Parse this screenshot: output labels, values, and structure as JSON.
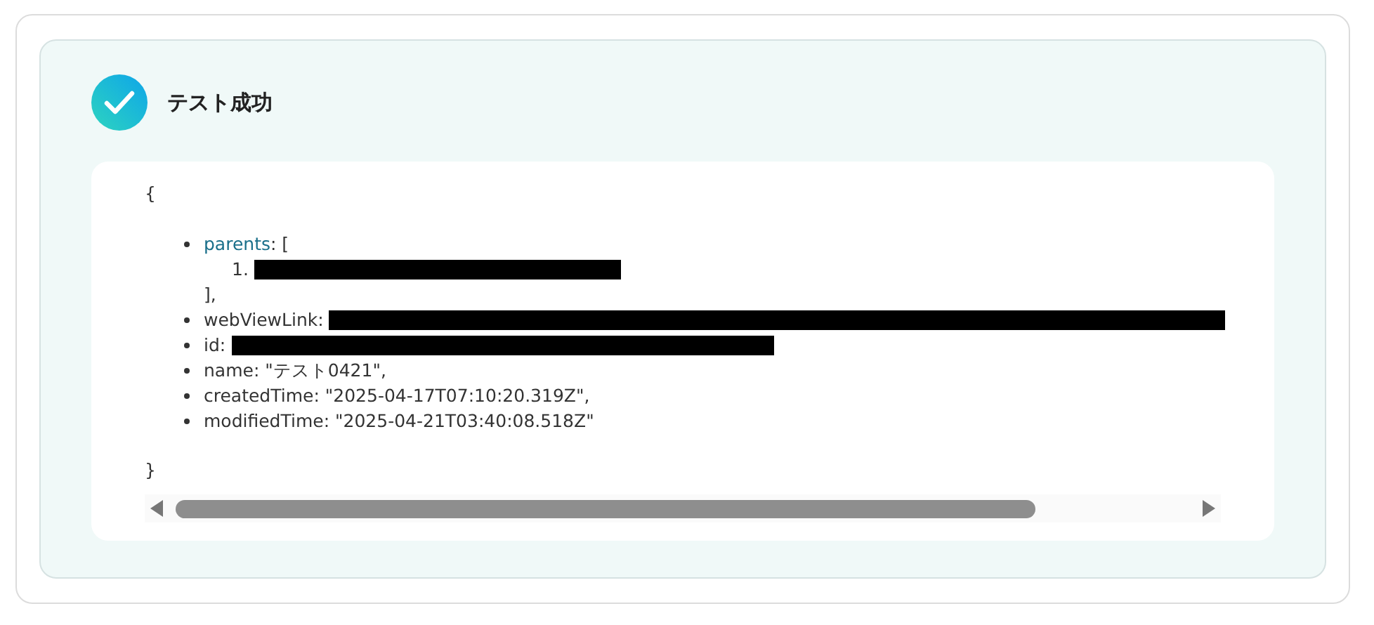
{
  "status": {
    "title": "テスト成功",
    "success": true
  },
  "result": {
    "open": "{",
    "close": "}",
    "fields": [
      {
        "key": "parents",
        "link": true,
        "open": ": [",
        "items": [
          {
            "marker": "1.",
            "redacted": true
          }
        ],
        "close": "],"
      },
      {
        "key": "webViewLink",
        "link": false,
        "value": ":",
        "redacted": true
      },
      {
        "key": "id",
        "link": false,
        "value": ":",
        "redacted": true
      },
      {
        "key": "name",
        "link": false,
        "value": ": \"テスト0421\","
      },
      {
        "key": "createdTime",
        "link": false,
        "value": ": \"2025-04-17T07:10:20.319Z\","
      },
      {
        "key": "modifiedTime",
        "link": false,
        "value": ": \"2025-04-21T03:40:08.518Z\""
      }
    ]
  }
}
